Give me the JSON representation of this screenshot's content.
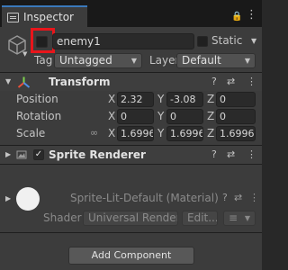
{
  "window": {
    "tab_label": "Inspector",
    "lock_icon": "lock-icon",
    "menu_icon": "kebab-menu-icon"
  },
  "gameobject": {
    "name": "enemy1",
    "static_label": "Static",
    "tag_label": "Tag",
    "tag_value": "Untagged",
    "layer_label": "Layer",
    "layer_value": "Default",
    "highlight_color": "#e8151b"
  },
  "transform": {
    "title": "Transform",
    "rows": [
      {
        "label": "Position",
        "x": "2.32",
        "y": "-3.08",
        "z": "0"
      },
      {
        "label": "Rotation",
        "x": "0",
        "y": "0",
        "z": "0"
      },
      {
        "label": "Scale",
        "x": "1.6996",
        "y": "1.6996",
        "z": "1.6996"
      }
    ],
    "axis": {
      "x": "X",
      "y": "Y",
      "z": "Z"
    }
  },
  "sprite_renderer": {
    "title": "Sprite Renderer",
    "enabled_mark": "✓"
  },
  "material": {
    "name": "Sprite-Lit-Default (Material)",
    "shader_label": "Shader",
    "shader_value": "Universal Render P",
    "edit_label": "Edit...",
    "list_icon": "≡"
  },
  "footer": {
    "add_component_label": "Add Component"
  },
  "icons": {
    "help": "?",
    "settings": "⇄",
    "more": "⋮"
  }
}
